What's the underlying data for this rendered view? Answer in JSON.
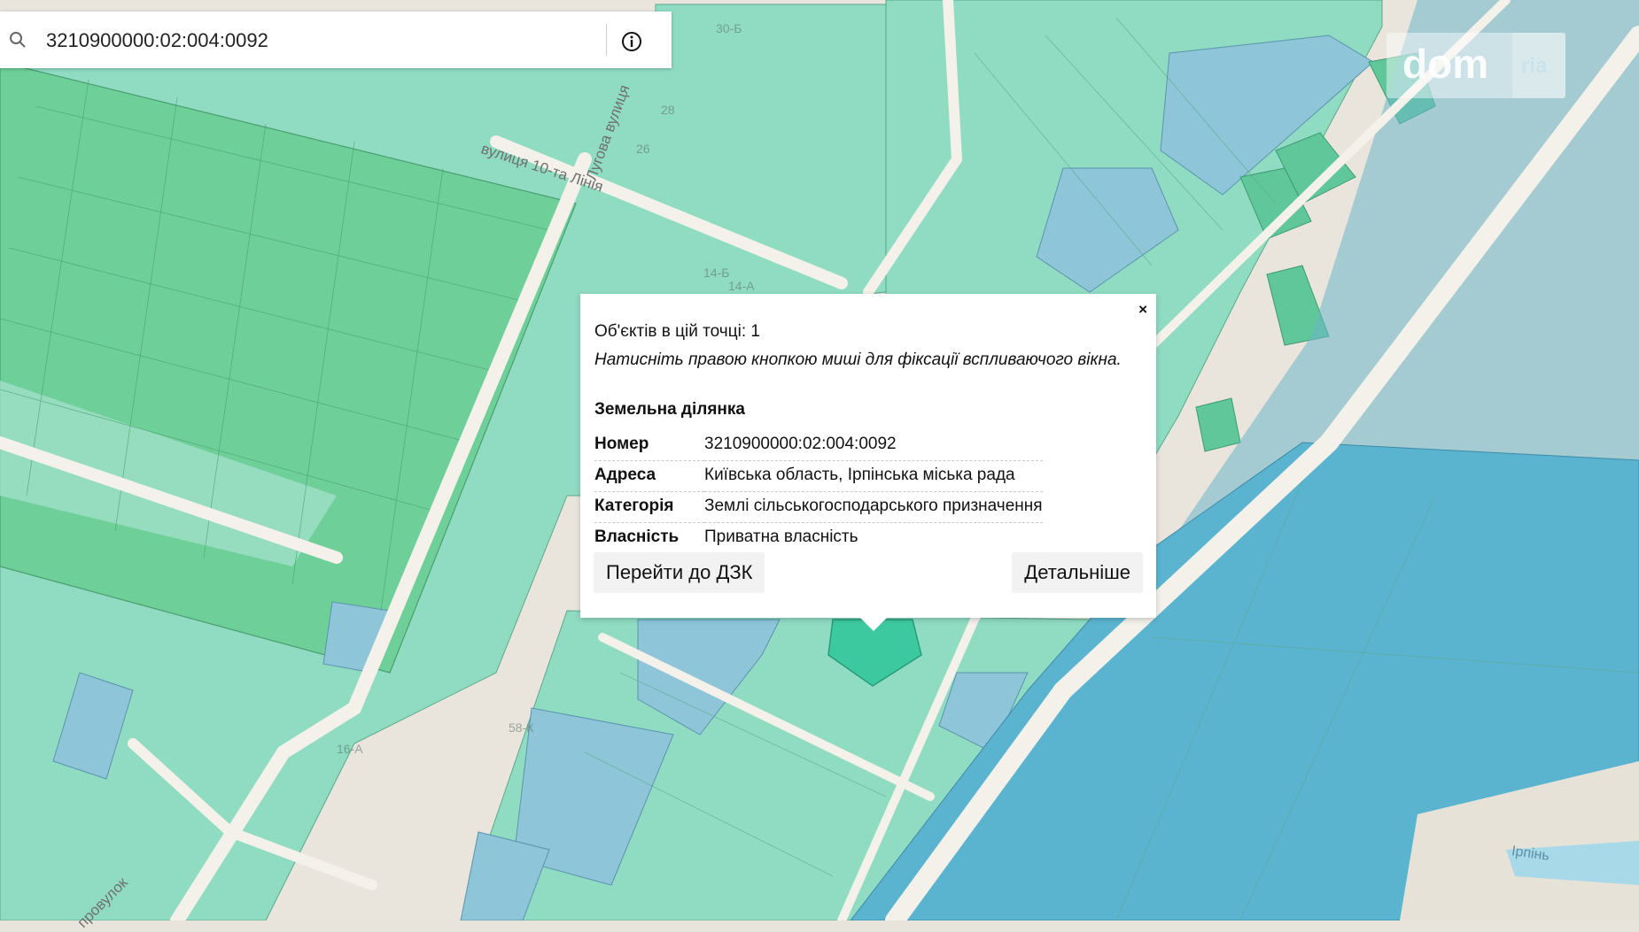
{
  "search": {
    "value": "3210900000:02:004:0092",
    "search_icon": "search-icon",
    "info_icon": "info-circle-icon"
  },
  "logo": {
    "dom": "dom",
    "ria": "ria"
  },
  "map_labels": {
    "street_10_linia": "вулиця 10-та Лінія",
    "street_luhova": "Лугова вулиця",
    "lane": "провулок",
    "river": "Ірпінь"
  },
  "house_numbers": [
    "30-Б",
    "28",
    "26",
    "14-Б",
    "14-А",
    "58-К",
    "16-А"
  ],
  "popup": {
    "close": "×",
    "objects_count": "Об'єктів в цій точці: 1",
    "hint": "Натисніть правою кнопкою миші для фіксації вспливаючого вікна.",
    "section_title": "Земельна ділянка",
    "rows": [
      {
        "key": "Номер",
        "value": "3210900000:02:004:0092"
      },
      {
        "key": "Адреса",
        "value": "Київська область, Ірпінська міська рада"
      },
      {
        "key": "Категорія",
        "value": "Землі сільськогосподарського призначення"
      },
      {
        "key": "Власність",
        "value": "Приватна власність"
      }
    ],
    "button_dzk": "Перейти до ДЗК",
    "button_details": "Детальніше"
  },
  "colors": {
    "parcel_green": "#8fdcc3",
    "parcel_dark_green": "#5fc79a",
    "parcel_blue": "#8ec5d9",
    "water_blue": "#5ab4d0",
    "selected_parcel": "#3cc9a0",
    "road": "#f4f1ea"
  }
}
